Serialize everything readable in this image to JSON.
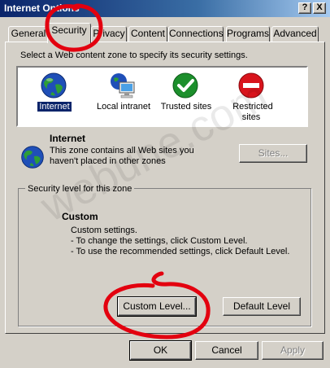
{
  "window": {
    "title": "Internet Options",
    "help_button": "?",
    "close_button": "X"
  },
  "tabs": [
    {
      "label": "General"
    },
    {
      "label": "Security"
    },
    {
      "label": "Privacy"
    },
    {
      "label": "Content"
    },
    {
      "label": "Connections"
    },
    {
      "label": "Programs"
    },
    {
      "label": "Advanced"
    }
  ],
  "security": {
    "instruction": "Select a Web content zone to specify its security settings.",
    "zones": [
      {
        "label": "Internet",
        "icon": "globe-icon"
      },
      {
        "label": "Local intranet",
        "icon": "local-intranet-icon"
      },
      {
        "label": "Trusted sites",
        "icon": "checkmark-icon"
      },
      {
        "label": "Restricted sites",
        "icon": "restricted-icon"
      }
    ],
    "selected_zone_title": "Internet",
    "zone_description_line1": "This zone contains all Web sites you",
    "zone_description_line2": "haven't placed in other zones",
    "sites_button": "Sites...",
    "level_group_label": "Security level for this zone",
    "level_title": "Custom",
    "level_line1": "Custom settings.",
    "level_line2": "- To change the settings, click Custom Level.",
    "level_line3": "- To use the recommended settings, click Default Level.",
    "custom_level_button": "Custom Level...",
    "default_level_button": "Default Level"
  },
  "footer": {
    "ok": "OK",
    "cancel": "Cancel",
    "apply": "Apply"
  },
  "watermark": "webune.com",
  "colors": {
    "title_bar": "#0a246a",
    "window_face": "#d4d0c8",
    "selection": "#0a246a",
    "annotation_red": "#e3000f"
  }
}
